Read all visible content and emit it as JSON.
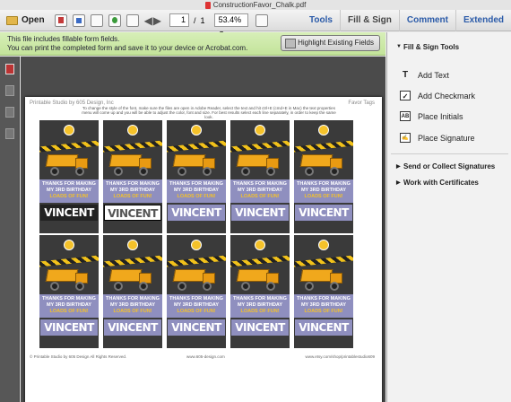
{
  "window": {
    "title": "ConstructionFavor_Chalk.pdf"
  },
  "toolbar": {
    "open_label": "Open",
    "page_current": "1",
    "page_separator": "/",
    "page_total": "1",
    "zoom": "53.4%",
    "tools_label": "Tools",
    "tabs": [
      "Fill & Sign",
      "Comment",
      "Extended"
    ]
  },
  "formbar": {
    "line1": "This file includes fillable form fields.",
    "line2": "You can print the completed form and save it to your device or Acrobat.com.",
    "highlight_button": "Highlight Existing Fields"
  },
  "document": {
    "header_left": "Printable Studio by 605 Design, Inc",
    "header_right": "Favor Tags",
    "instructions": "To change the style of the font, make sure the files are open in Adobe Reader, select the text and hit ctrl+E (cmd+E in Mac) the text properties menu will come up and you will be able to adjust the color, font and size. For best results select each line separately, in order to keep the same look.",
    "tag_lines": [
      "THANKS FOR MAKING",
      "MY 3RD BIRTHDAY",
      "LOADS OF FUN!"
    ],
    "tag_name": "VINCENT",
    "footer_left": "© Printable Studio by 605 Design All Rights Reserved.",
    "footer_center": "www.605-design.com",
    "footer_right": "www.etsy.com/shop/printablestudio609"
  },
  "right_pane": {
    "section_fill_sign": "Fill & Sign Tools",
    "tools": [
      "Add Text",
      "Add Checkmark",
      "Place Initials",
      "Place Signature"
    ],
    "section_send": "Send or Collect Signatures",
    "section_certs": "Work with Certificates"
  },
  "colors": {
    "formbar_green": "#c8e6a0",
    "link_blue": "#2a5aa8",
    "tag_purple": "#8f8fbf",
    "tag_yellow": "#f5c22a"
  }
}
